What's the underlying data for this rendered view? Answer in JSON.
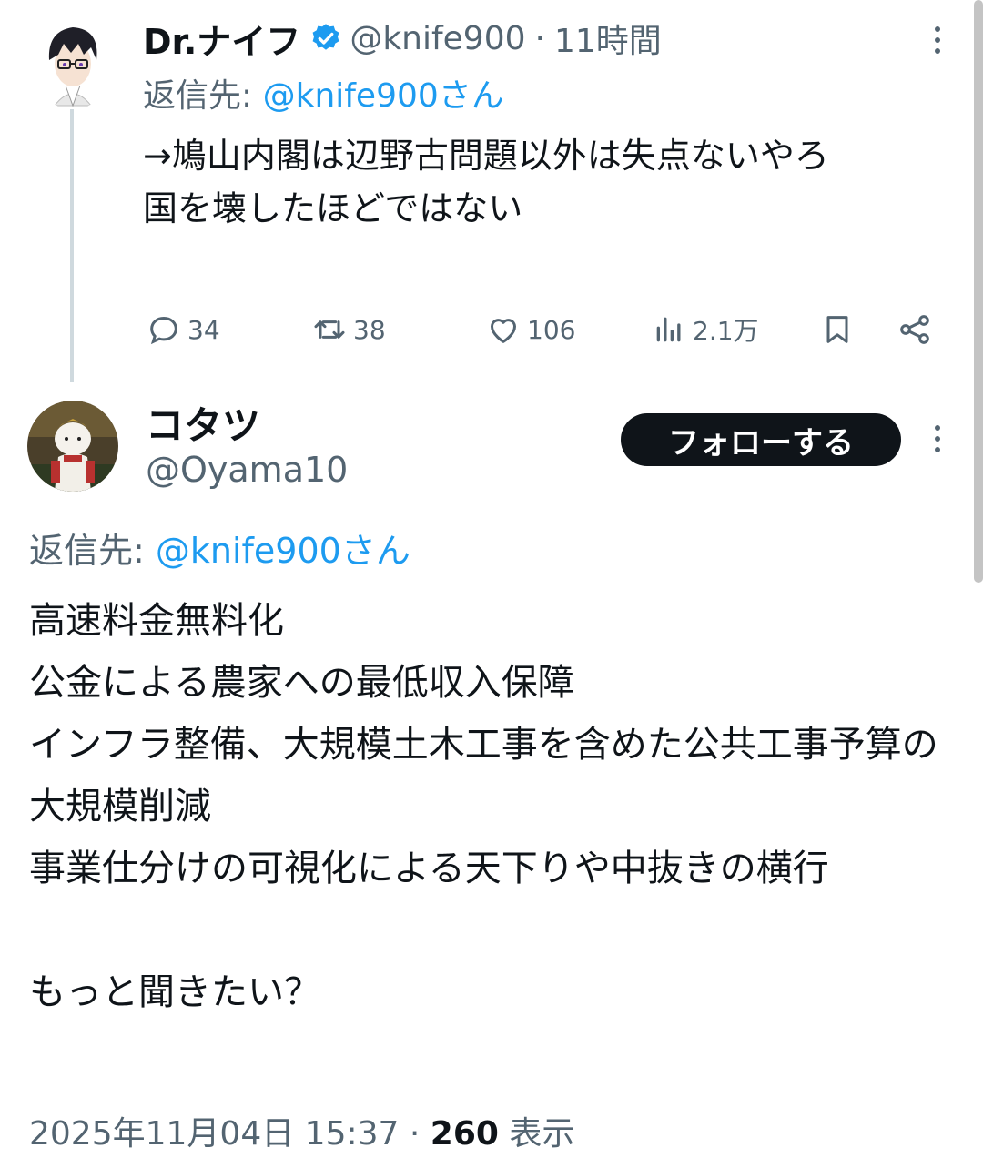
{
  "tweet1": {
    "author_name": "Dr.ナイフ",
    "handle": "@knife900",
    "separator": "·",
    "time": "11時間",
    "reply_label": "返信先:",
    "reply_to": "@knife900さん",
    "body": "→鳩山内閣は辺野古問題以外は失点ないやろ\n国を壊したほどではない",
    "actions": {
      "replies": "34",
      "retweets": "38",
      "likes": "106",
      "views": "2.1万"
    }
  },
  "tweet2": {
    "author_name": "コタツ",
    "handle": "@Oyama10",
    "follow_label": "フォローする",
    "reply_label": "返信先:",
    "reply_to": "@knife900さん",
    "body": "高速料金無料化\n公金による農家への最低収入保障\nインフラ整備、大規模土木工事を含めた公共工事予算の大規模削減\n事業仕分けの可視化による天下りや中抜きの横行\n\nもっと聞きたい？",
    "timestamp": "2025年11月04日 15:37",
    "separator": "·",
    "views_count": "260",
    "views_label": "表示"
  },
  "icons": [
    "verified-badge-icon",
    "more-icon",
    "reply-icon",
    "retweet-icon",
    "like-icon",
    "views-icon",
    "bookmark-icon",
    "share-icon"
  ],
  "colors": {
    "accent": "#1d9bf0",
    "muted": "#536471",
    "text": "#0f1419",
    "follow_button": "#0f1419"
  }
}
